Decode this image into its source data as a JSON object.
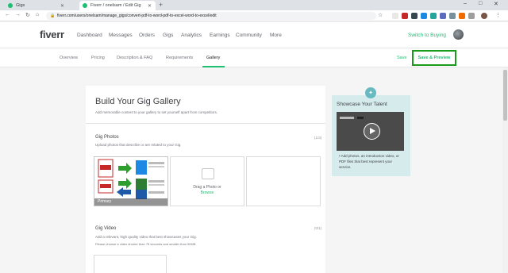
{
  "browser": {
    "tabs": [
      {
        "label": "Gigs",
        "active": false
      },
      {
        "label": "Fiverr / onelsam / Edit Gig",
        "active": true
      }
    ],
    "url": "fiverr.com/users/onelsam/manage_gigs/convert-pdf-to-word-pdf-to-excel-word-to-excel/edit",
    "window_controls": [
      "–",
      "□",
      "✕"
    ]
  },
  "header": {
    "logo": "fiverr",
    "nav": [
      "Dashboard",
      "Messages",
      "Orders",
      "Gigs",
      "Analytics",
      "Earnings",
      "Community",
      "More"
    ],
    "switch_label": "Switch to Buying"
  },
  "subnav": {
    "tabs": [
      "Overview",
      "Pricing",
      "Description & FAQ",
      "Requirements",
      "Gallery"
    ],
    "active_tab": "Gallery",
    "save_label": "Save",
    "save_preview_label": "Save & Preview"
  },
  "main": {
    "title": "Build Your Gig Gallery",
    "subtitle": "Add memorable content to your gallery to set yourself apart from competitors.",
    "photos": {
      "title": "Gig Photos",
      "desc": "Upload photos that describe or are related to your Gig.",
      "count": "(1/3)",
      "primary_label": "Primary",
      "drag_text": "Drag a Photo or",
      "browse_text": "Browse"
    },
    "video": {
      "title": "Gig Video",
      "desc": "Add a relevant, high quality video that best showcases your Gig.",
      "desc2": "Please choose a video shorter than 75 seconds and smaller than 50MB",
      "count": "(0/1)"
    }
  },
  "showcase": {
    "title": "Showcase Your Talent",
    "bullet": "Add photos, an introduction video, or PDF files that best represent your service."
  },
  "colors": {
    "brand": "#1dbf73",
    "highlight_border": "#1a9c1a",
    "showcase_bg": "#d6ecec"
  }
}
